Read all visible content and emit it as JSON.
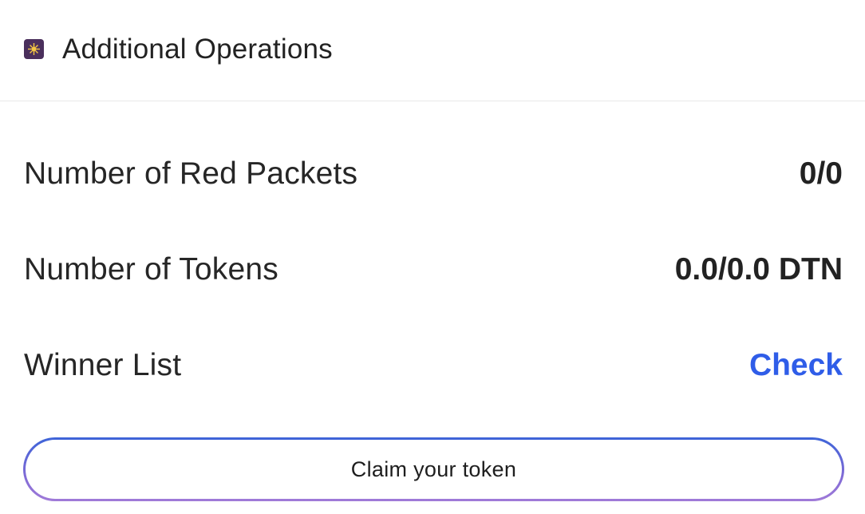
{
  "header": {
    "icon": "sparkle-icon",
    "title": "Additional Operations"
  },
  "rows": [
    {
      "label": "Number of Red Packets",
      "value": "0/0"
    },
    {
      "label": "Number of Tokens",
      "value": "0.0/0.0 DTN"
    },
    {
      "label": "Winner List",
      "link": "Check"
    }
  ],
  "claim_button": {
    "label": "Claim your token"
  },
  "colors": {
    "link": "#2f5de8",
    "icon_bg": "#4a2f5c",
    "icon_fg": "#f5c842",
    "button_gradient_start": "#3d64d8",
    "button_gradient_end": "#a07ad8"
  }
}
